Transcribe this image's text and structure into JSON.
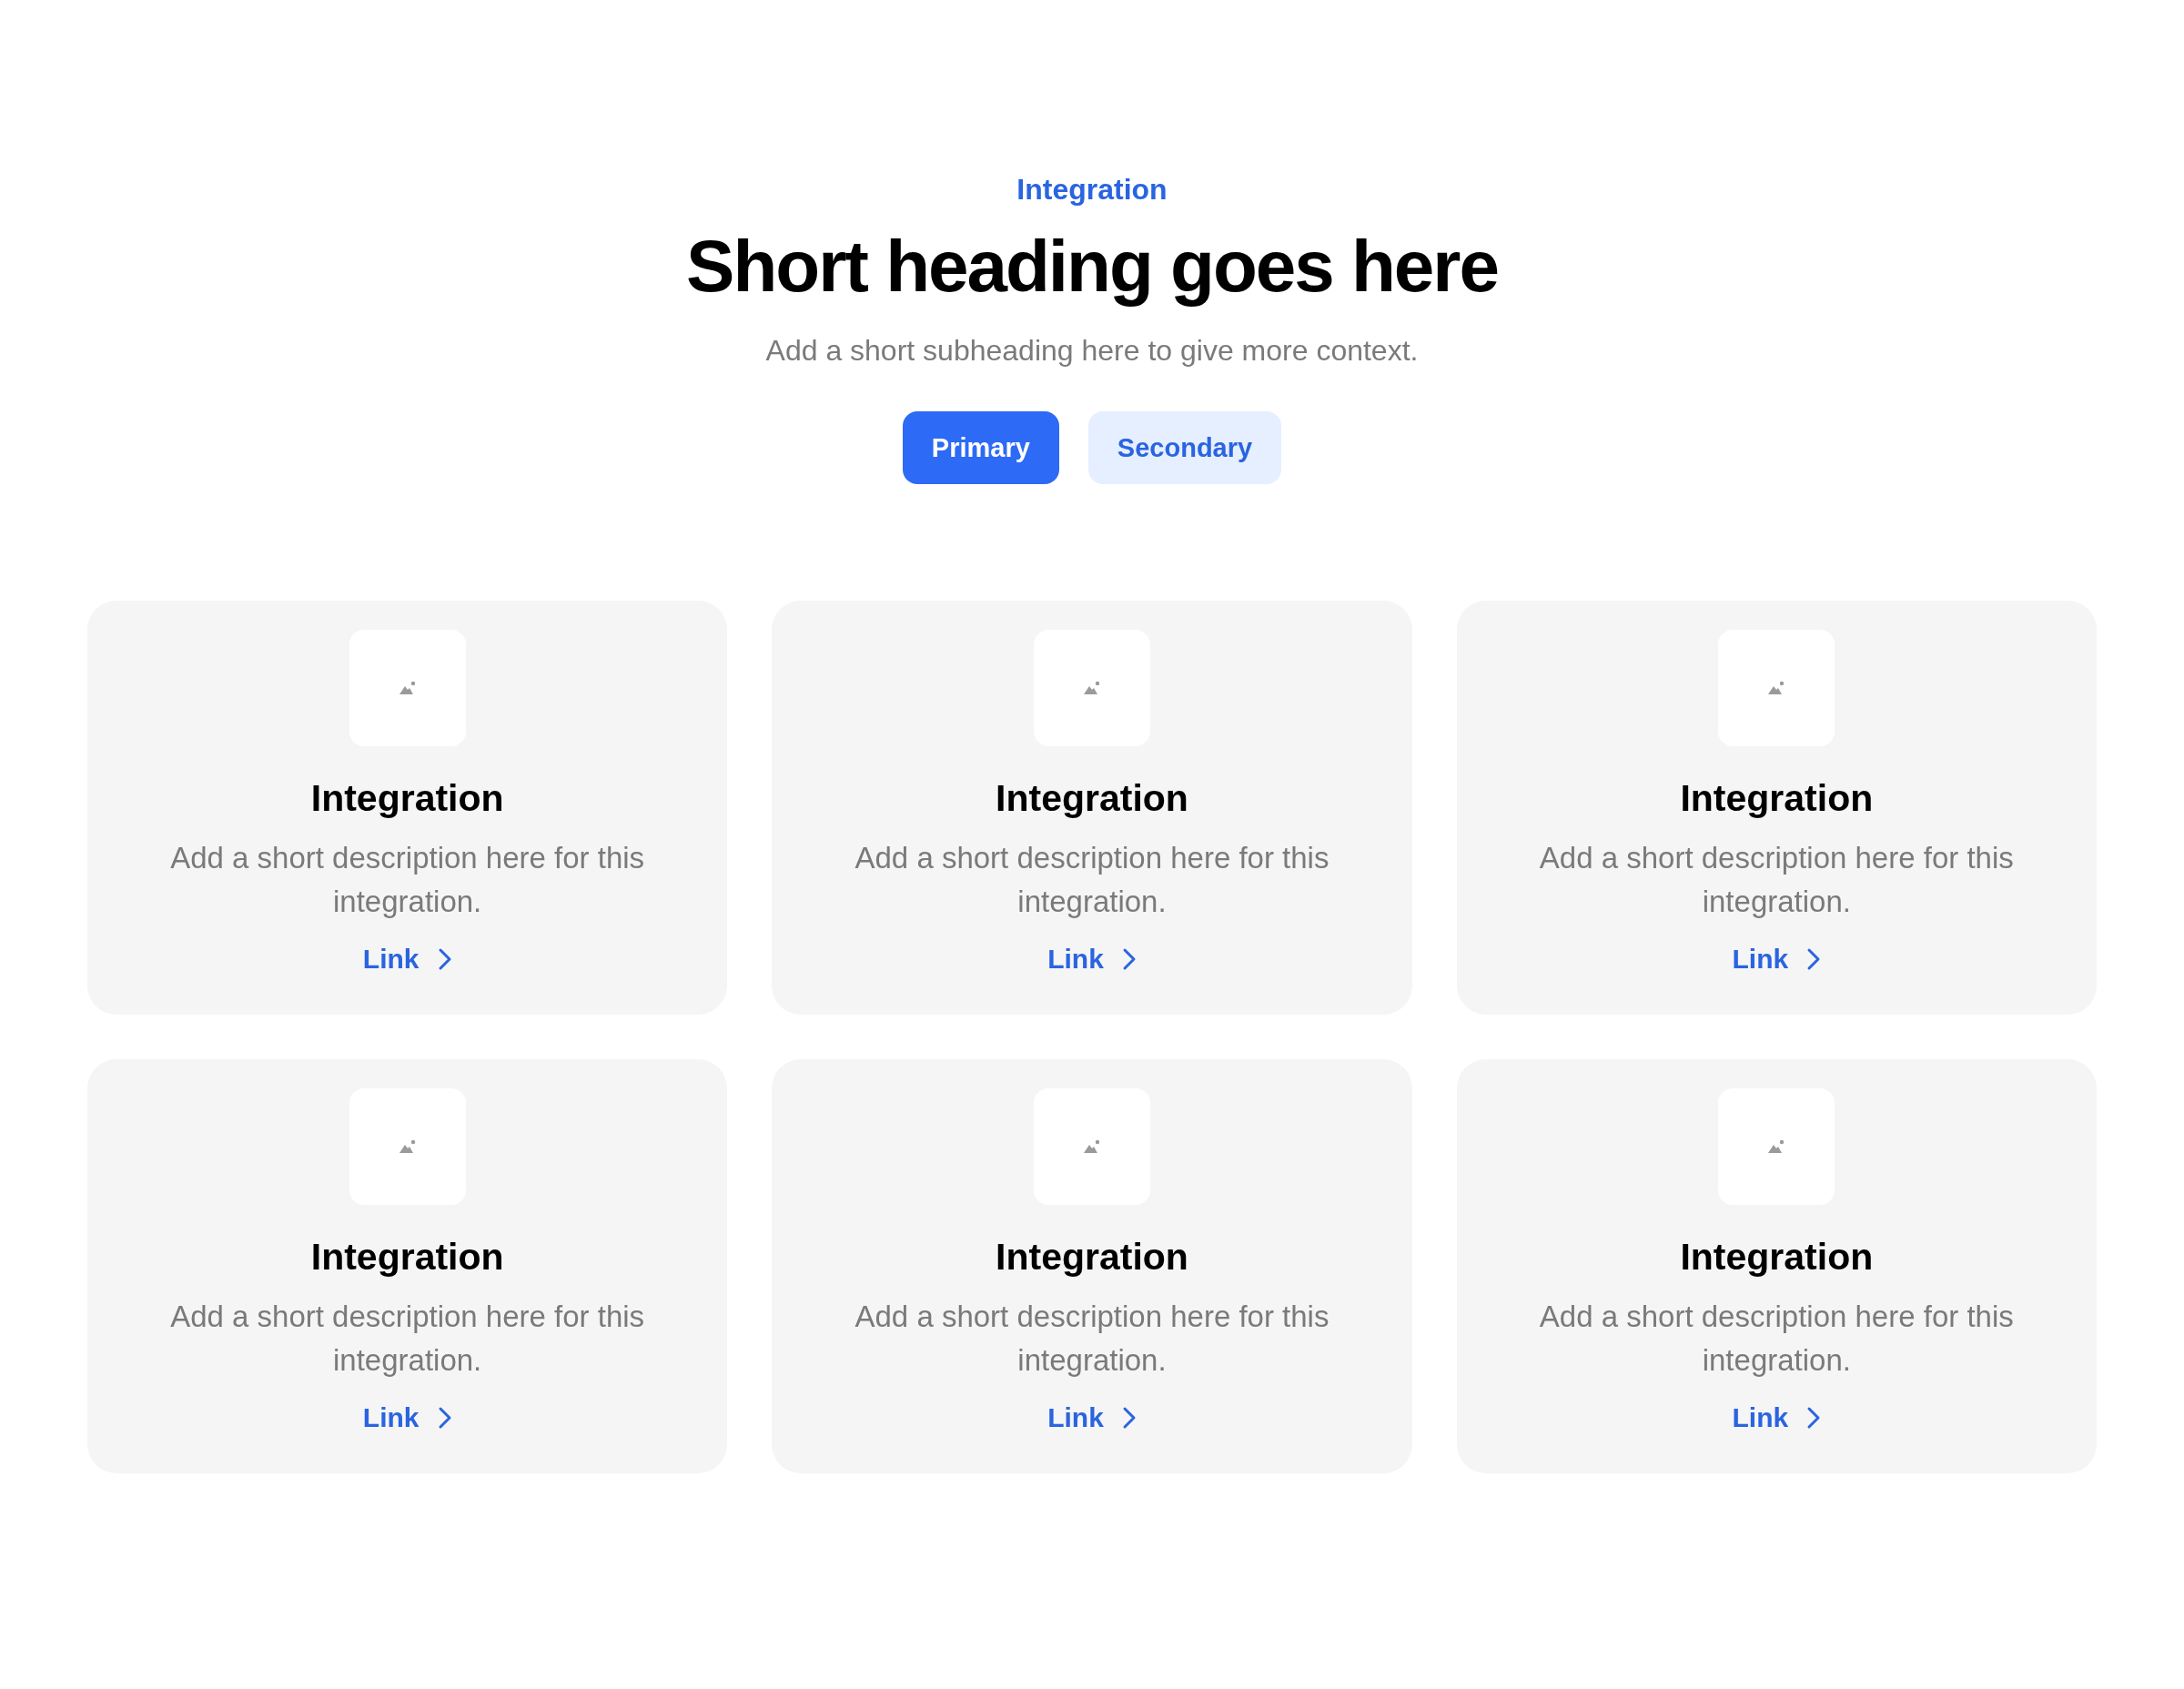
{
  "header": {
    "eyebrow": "Integration",
    "heading": "Short heading goes here",
    "subheading": "Add a short subheading here to give more context."
  },
  "buttons": [
    {
      "label": "Primary",
      "kind": "primary"
    },
    {
      "label": "Secondary",
      "kind": "secondary"
    }
  ],
  "cards": [
    {
      "title": "Integration",
      "description": "Add a short description here for this integration.",
      "link": "Link"
    },
    {
      "title": "Integration",
      "description": "Add a short description here for this integration.",
      "link": "Link"
    },
    {
      "title": "Integration",
      "description": "Add a short description here for this integration.",
      "link": "Link"
    },
    {
      "title": "Integration",
      "description": "Add a short description here for this integration.",
      "link": "Link"
    },
    {
      "title": "Integration",
      "description": "Add a short description here for this integration.",
      "link": "Link"
    },
    {
      "title": "Integration",
      "description": "Add a short description here for this integration.",
      "link": "Link"
    }
  ]
}
